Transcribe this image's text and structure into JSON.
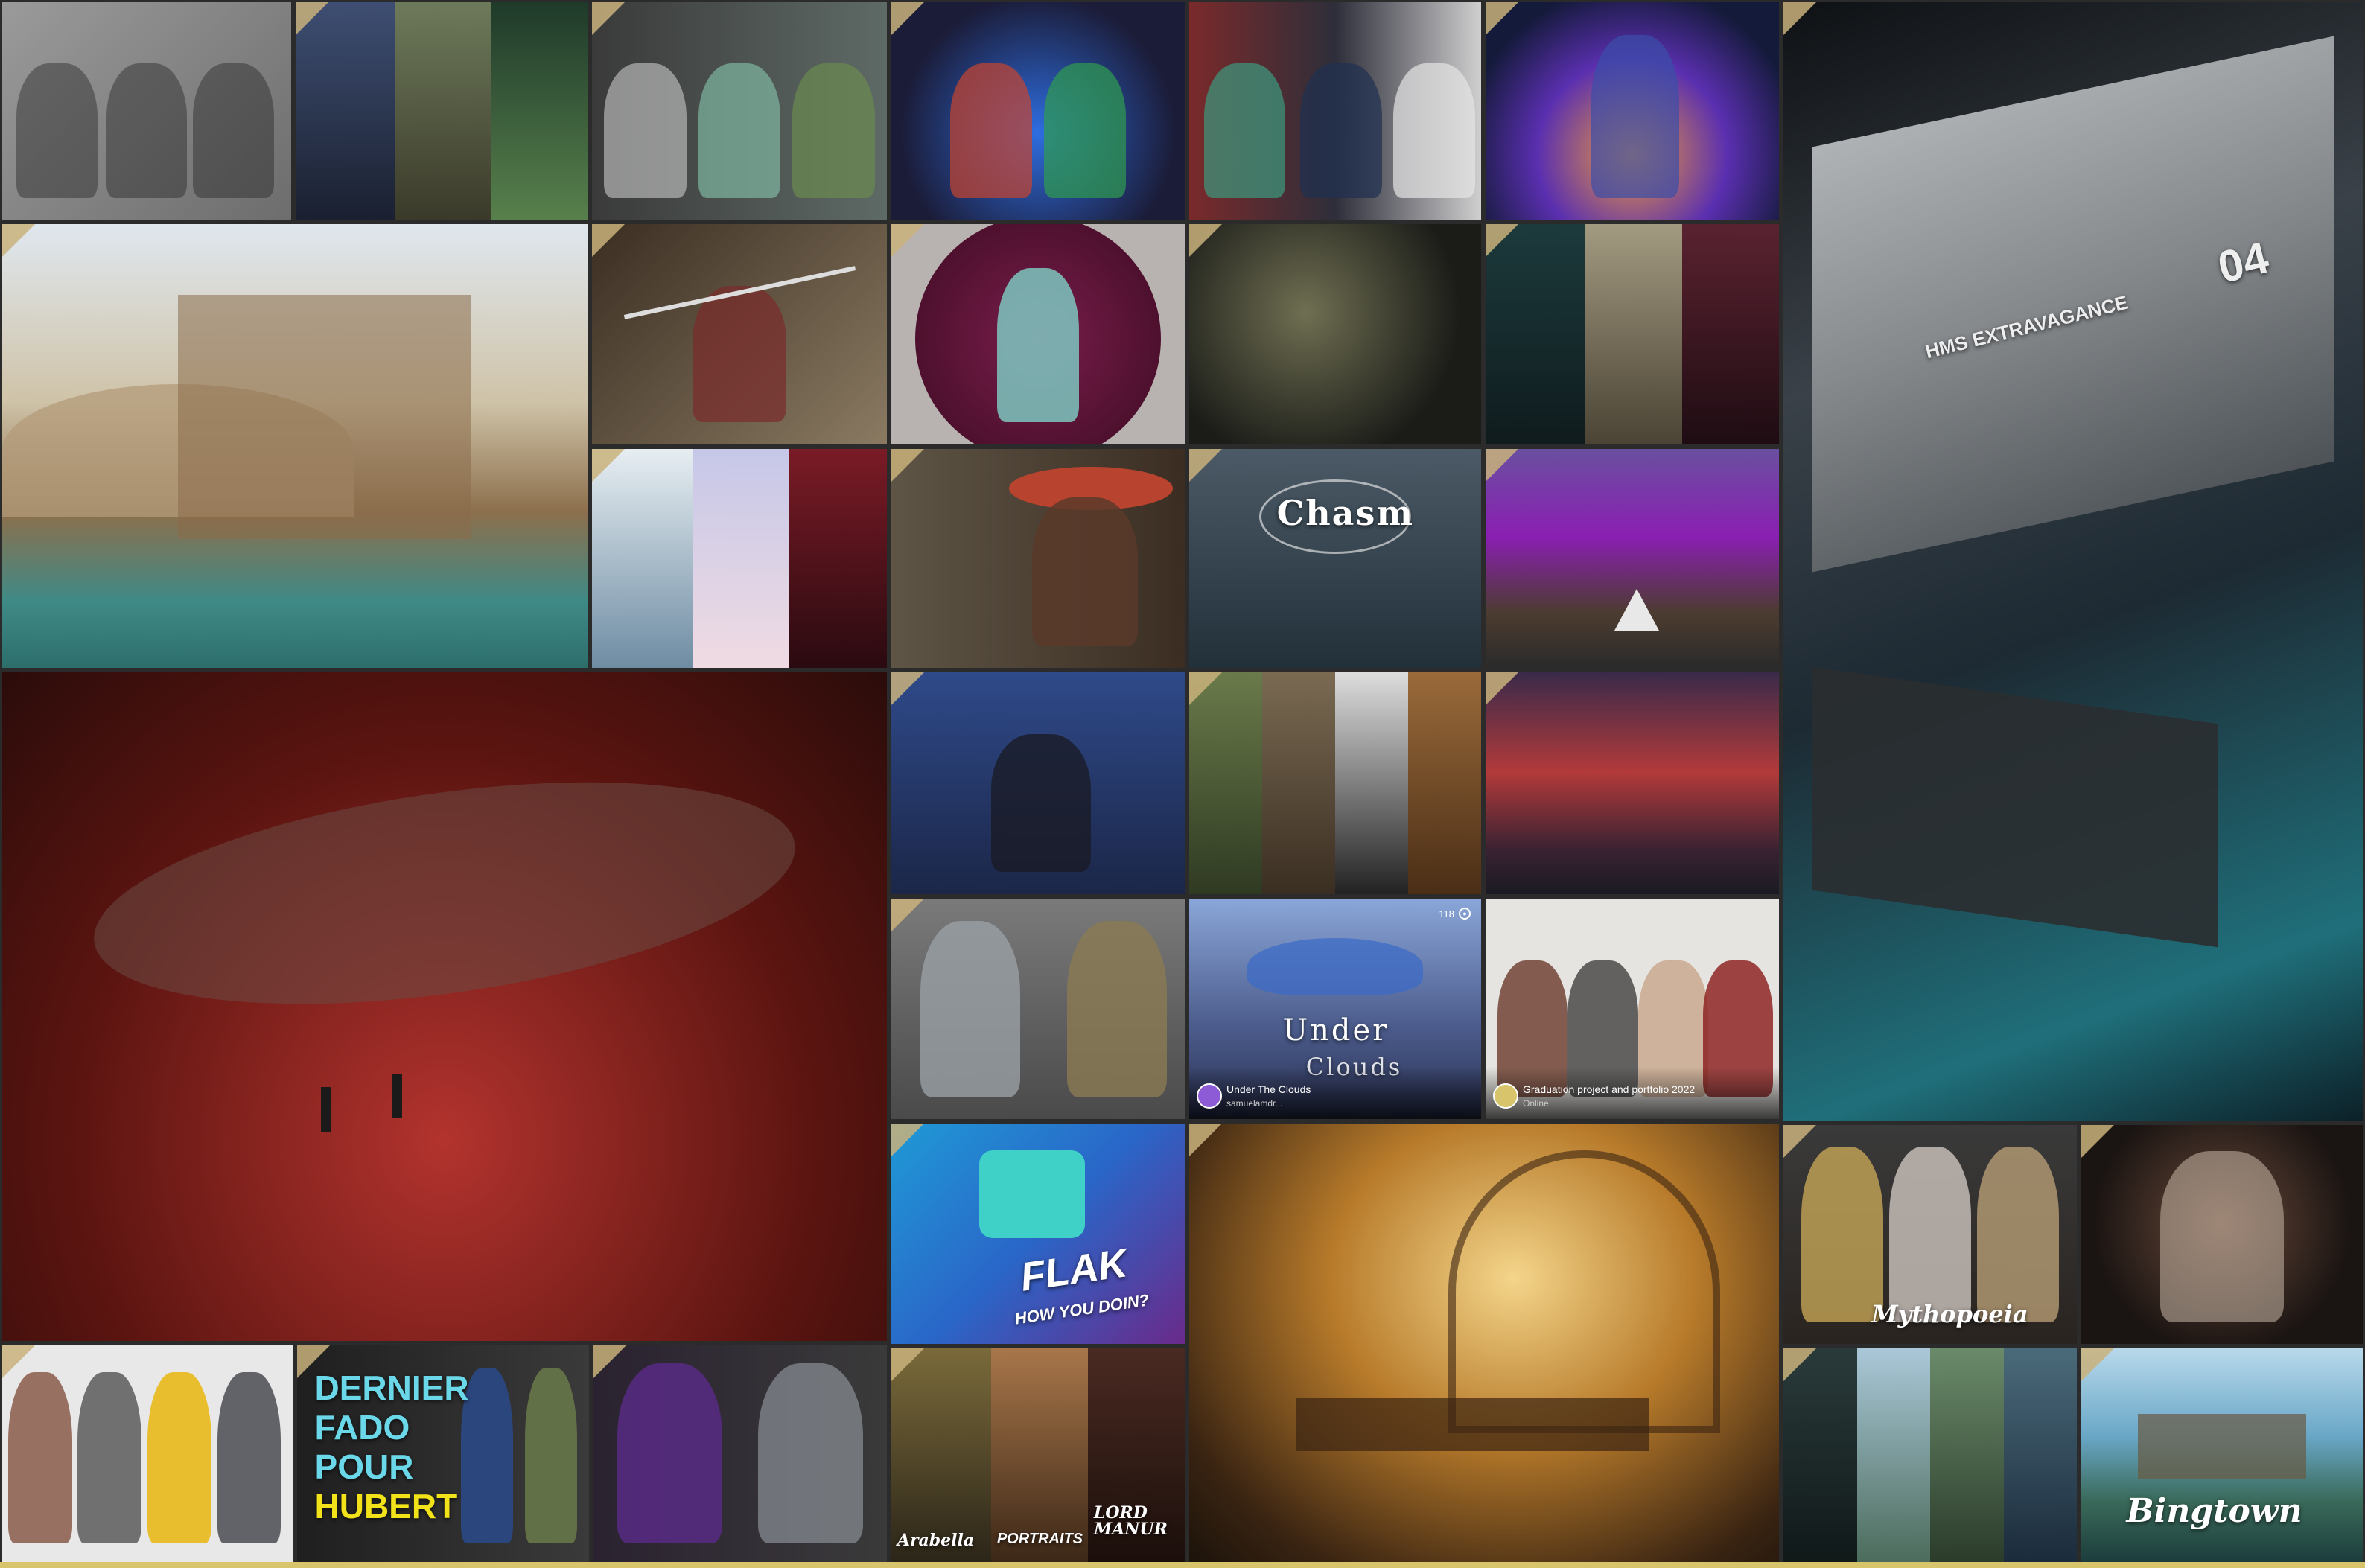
{
  "overlays": {
    "chasm_title": "Chasm",
    "under_the_clouds_line1": "Under",
    "under_the_clouds_line2": "Clouds",
    "under_the_clouds_card_title": "Under The Clouds",
    "under_the_clouds_card_sub": "samuelamdr...",
    "under_the_clouds_count": "118",
    "graduation_card_title": "Graduation project and portfolio 2022",
    "graduation_card_sub": "Online",
    "ship_label": "HMS EXTRAVAGANCE",
    "ship_number": "04",
    "flak_line1": "FLAK",
    "flak_line2": "HOW YOU DOIN?",
    "mythopoeia": "Mythopoeia",
    "dernier_line1": "DERNIER",
    "dernier_line2": "FADO",
    "dernier_line3": "POUR",
    "dernier_line4": "HUBERT",
    "arabella": "Arabella",
    "portraits": "PORTRAITS",
    "lord_manur": "LORD MANUR",
    "bingtown": "Bingtown"
  },
  "icons": {
    "featured_ribbon": "featured-ribbon-icon",
    "eye": "eye-icon"
  },
  "colors": {
    "background": "#2b2b2b",
    "ribbon": "#c9b27b",
    "bottom_strip": "#d8c46a"
  }
}
